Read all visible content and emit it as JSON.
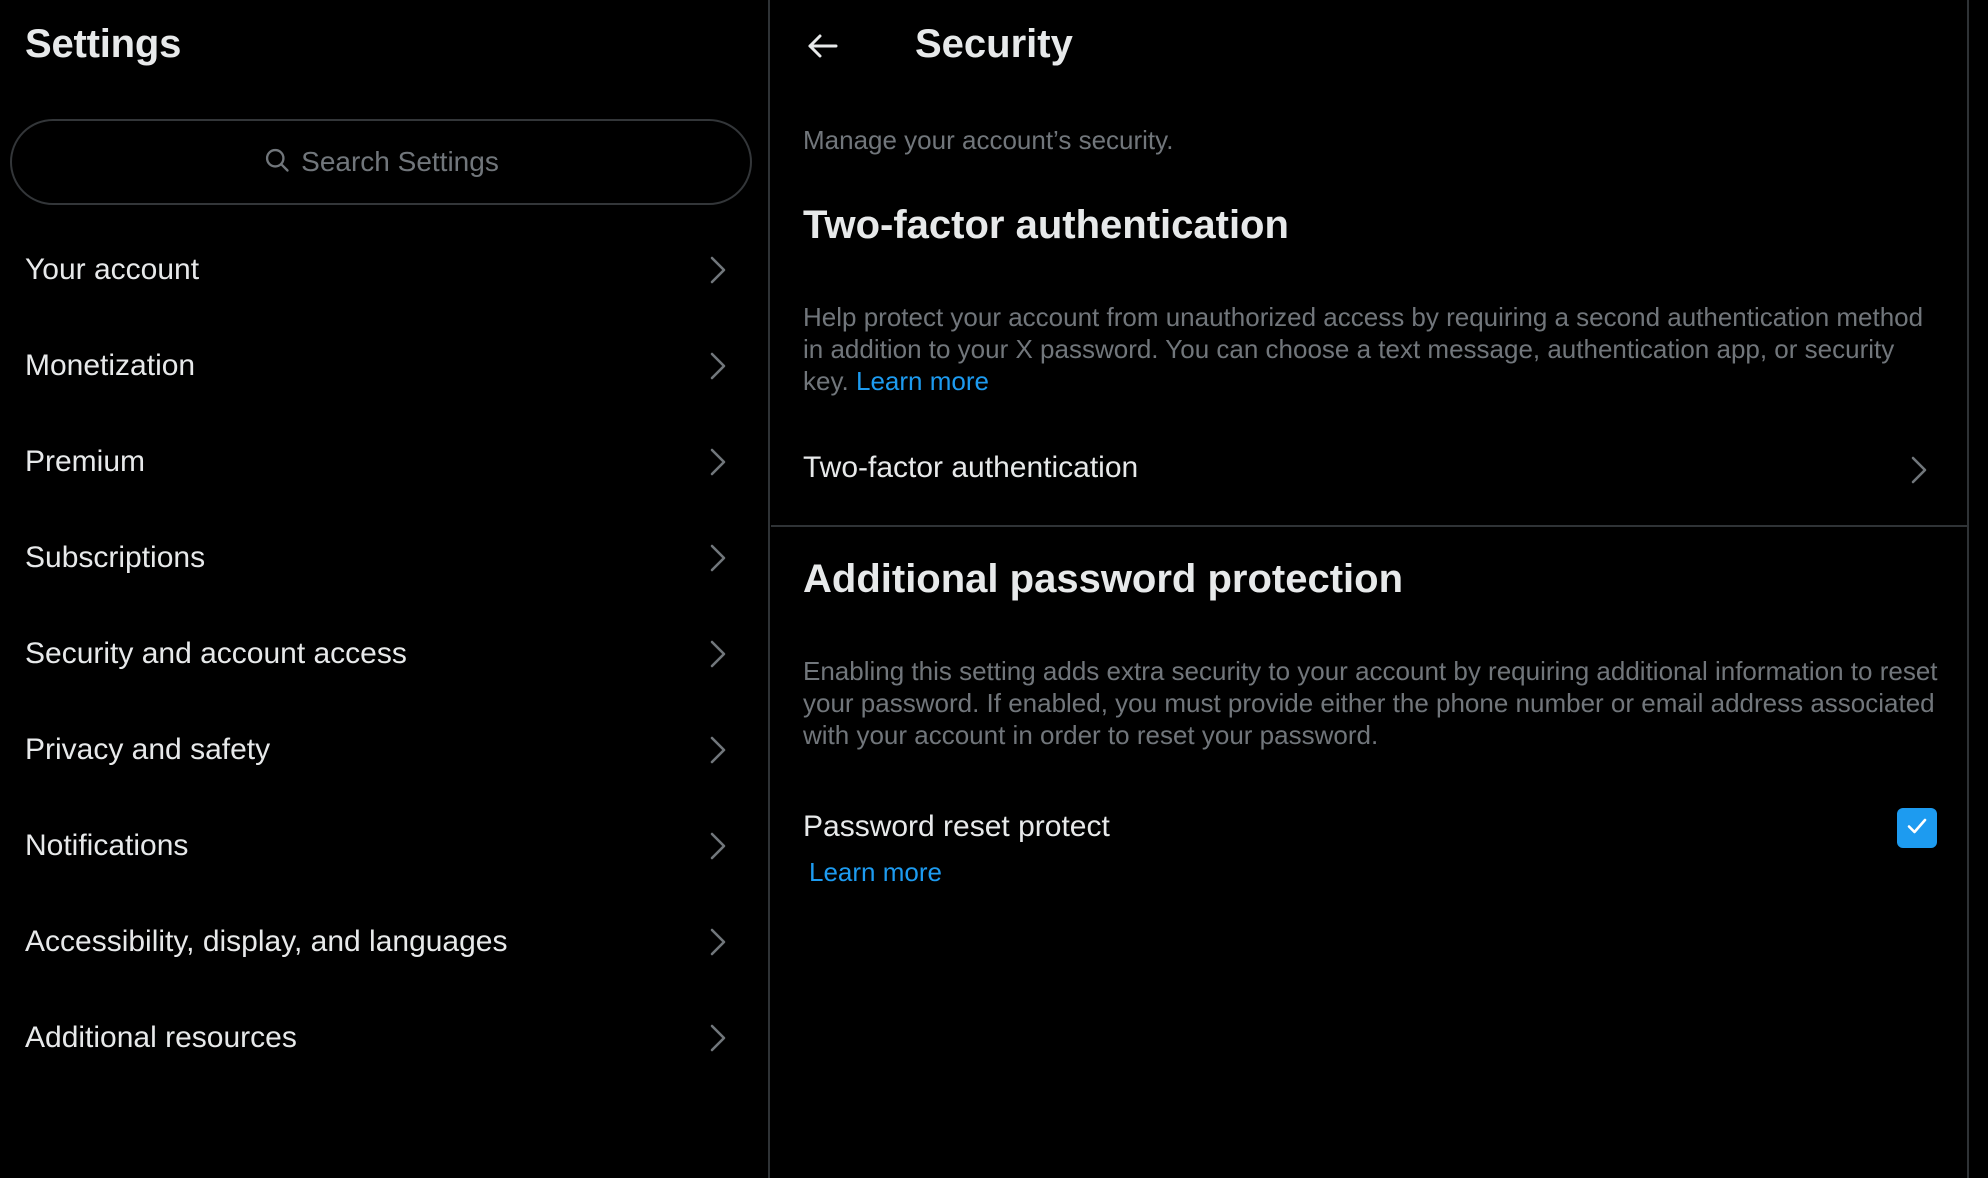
{
  "sidebar": {
    "title": "Settings",
    "search": {
      "placeholder": "Search Settings",
      "icon": "search-icon"
    },
    "items": [
      {
        "label": "Your account",
        "icon": "chevron-right-icon"
      },
      {
        "label": "Monetization",
        "icon": "chevron-right-icon"
      },
      {
        "label": "Premium",
        "icon": "chevron-right-icon"
      },
      {
        "label": "Subscriptions",
        "icon": "chevron-right-icon"
      },
      {
        "label": "Security and account access",
        "icon": "chevron-right-icon"
      },
      {
        "label": "Privacy and safety",
        "icon": "chevron-right-icon"
      },
      {
        "label": "Notifications",
        "icon": "chevron-right-icon"
      },
      {
        "label": "Accessibility, display, and languages",
        "icon": "chevron-right-icon"
      },
      {
        "label": "Additional resources",
        "icon": "chevron-right-icon"
      }
    ]
  },
  "main": {
    "back_icon": "arrow-left-icon",
    "title": "Security",
    "subtitle": "Manage your account’s security.",
    "two_factor": {
      "heading": "Two-factor authentication",
      "description": "Help protect your account from unauthorized access by requiring a second authentication method in addition to your X password. You can choose a text message, authentication app, or security key.",
      "learn_more": "Learn more",
      "row_label": "Two-factor authentication"
    },
    "password_protection": {
      "heading": "Additional password protection",
      "description": "Enabling this setting adds extra security to your account by requiring additional information to reset your password. If enabled, you must provide either the phone number or email address associated with your account in order to reset your password.",
      "toggle_label": "Password reset protect",
      "learn_more": "Learn more",
      "checked": true
    }
  },
  "colors": {
    "background": "#000000",
    "text_primary": "#e7e9ea",
    "text_secondary": "#71767b",
    "accent": "#1d9bf0",
    "divider": "#2f3336"
  }
}
